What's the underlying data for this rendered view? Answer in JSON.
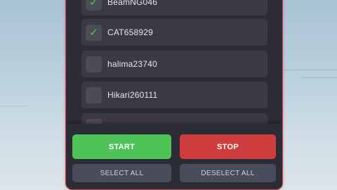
{
  "accounts": [
    {
      "name": "BeamNG046",
      "checked": true
    },
    {
      "name": "CAT658929",
      "checked": true
    },
    {
      "name": "halima23740",
      "checked": false
    },
    {
      "name": "Hikari260111",
      "checked": false
    },
    {
      "name": "",
      "checked": false
    }
  ],
  "check_glyph": "✓",
  "buttons": {
    "start": "START",
    "stop": "STOP",
    "select_all": "SELECT ALL",
    "deselect_all": "DESELECT ALL"
  },
  "colors": {
    "start": "#4ec458",
    "stop": "#cd3d3d",
    "panel_border": "#d6415a",
    "check": "#3fd24d"
  }
}
